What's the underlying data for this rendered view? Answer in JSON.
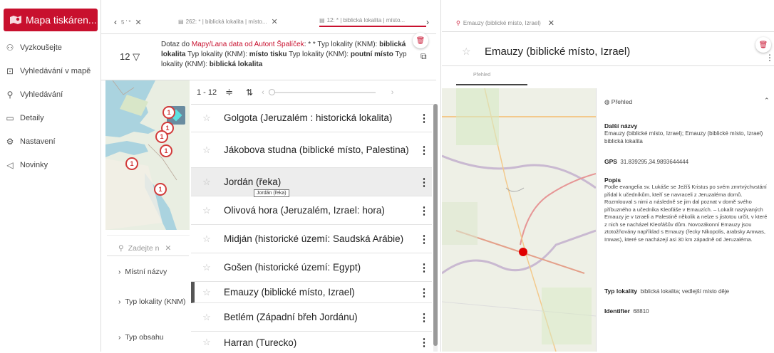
{
  "brand": {
    "title": "Mapa tiskáren..."
  },
  "nav": [
    {
      "label": "Vyzkoušejte",
      "icon": "user-icon"
    },
    {
      "label": "Vyhledávání v mapě",
      "icon": "map-search-icon"
    },
    {
      "label": "Vyhledávání",
      "icon": "search-icon"
    },
    {
      "label": "Detaily",
      "icon": "folder-icon"
    },
    {
      "label": "Nastavení",
      "icon": "gear-icon"
    },
    {
      "label": "Novinky",
      "icon": "megaphone-icon"
    }
  ],
  "tabs": {
    "t1": "5 ' *",
    "t2": "262: * | biblická lokalita | místo...",
    "t3": "12: * | biblická lokalita | místo..."
  },
  "query": {
    "count": "12",
    "prefix": "Dotaz do ",
    "source": "Mapy/Lana data od Autont Špalíček",
    "line1_rest": ": * * Typ lokality (KNM):",
    "b1": "biblická lokalita",
    "t1": " Typ lokality (KNM): ",
    "b2": "místo tisku",
    "t2": " Typ lokality (KNM):",
    "b3": "poutní místo",
    "t3": " Typ lokality (KNM): ",
    "b4": "biblická lokalita"
  },
  "list_header": {
    "range": "1 - 12"
  },
  "results": [
    {
      "name": "Golgota (Jeruzalém : historická lokalita)"
    },
    {
      "name": "Jákobova studna (biblické místo, Palestina)"
    },
    {
      "name": "Jordán (řeka)"
    },
    {
      "name": "Olivová hora (Jeruzalém, Izrael: hora)"
    },
    {
      "name": "Midján (historické území: Saudská Arábie)"
    },
    {
      "name": "Gošen (historické území: Egypt)"
    },
    {
      "name": "Emauzy (biblické místo, Izrael)"
    },
    {
      "name": "Betlém (Západní břeh Jordánu)"
    },
    {
      "name": "Harran (Turecko)"
    }
  ],
  "tooltip": "Jordán (řeka)",
  "filter": {
    "placeholder": "Zadejte n",
    "items": [
      "Místní názvy",
      "Typ lokality (KNM)",
      "Typ obsahu"
    ]
  },
  "map_markers": [
    "1",
    "1",
    "1",
    "1",
    "1",
    "1"
  ],
  "detail": {
    "tab_title": "Emauzy (biblické místo, Izrael)",
    "title": "Emauzy (biblické místo, Izrael)",
    "subtab": "Přehled",
    "section": "Přehled",
    "other_names_label": "Další názvy",
    "other_names": "Emauzy (biblické místo, Izrael); Emauzy (biblické místo, Izrael) biblická lokalita",
    "gps_label": "GPS",
    "gps": "31.839295,34.9893644444",
    "desc_label": "Popis",
    "desc": "Podle evangelia sv. Lukáše se Ježíš Kristus po svém zmrtvýchvstání přidal k učedníkům, kteří se navraceli z Jeruzaléma domů. Rozmlouval s nimi a následně se jim dal poznat v domě svého příbuzného a učedníka Kleofáše v Emauzích. – Lokalit nazývaných Emauzy je v Izraeli a Palestině několik a nelze s jistotou určit, v které z nich se nacházel Kleofášův dům. Novozákonní Emauzy jsou ztotožňovány například s Emauzy (řecky Nikopolis, arabsky Amwas, Imwas), které se nacházejí asi 30 km západně od Jeruzaléma.",
    "type_label": "Typ lokality",
    "type": "biblická lokalita; vedlejší místo děje",
    "id_label": "Identifier",
    "id": "68810"
  },
  "colors": {
    "accent": "#c8102e",
    "marker": "#e00000"
  }
}
